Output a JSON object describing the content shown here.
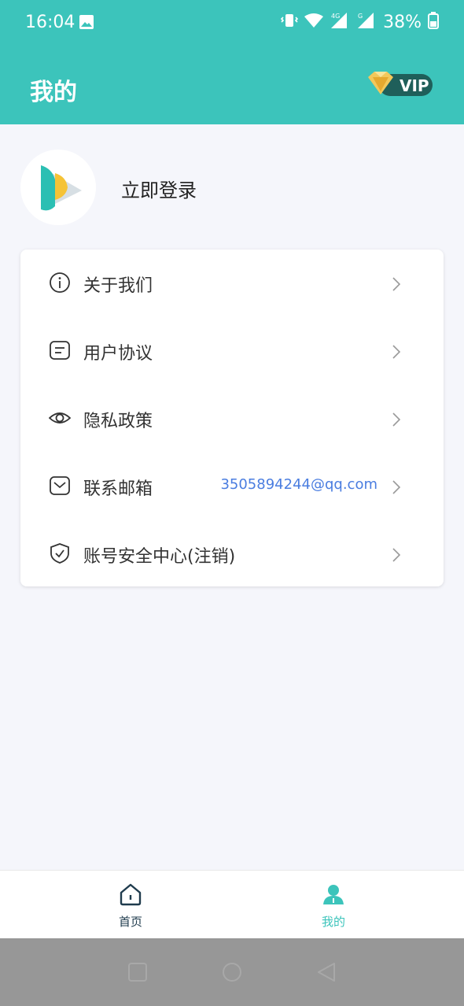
{
  "status_bar": {
    "time": "16:04",
    "battery": "38%",
    "icons": [
      "image-icon",
      "vibrate-icon",
      "wifi-icon",
      "signal-4g-icon",
      "signal-g-icon",
      "battery-icon"
    ]
  },
  "header": {
    "title": "我的",
    "vip_label": "VIP",
    "background": "#3cc4bb"
  },
  "profile": {
    "login_text": "立即登录"
  },
  "menu": [
    {
      "label": "关于我们",
      "icon": "info-icon",
      "value": ""
    },
    {
      "label": "用户协议",
      "icon": "document-icon",
      "value": ""
    },
    {
      "label": "隐私政策",
      "icon": "eye-icon",
      "value": ""
    },
    {
      "label": "联系邮箱",
      "icon": "mail-icon",
      "value": "3505894244@qq.com"
    },
    {
      "label": "账号安全中心(注销)",
      "icon": "shield-icon",
      "value": ""
    }
  ],
  "bottom_nav": {
    "home_label": "首页",
    "mine_label": "我的",
    "active": "mine",
    "active_color": "#3cc4bb"
  },
  "system_nav": [
    "square-icon",
    "circle-icon",
    "back-triangle-icon"
  ]
}
